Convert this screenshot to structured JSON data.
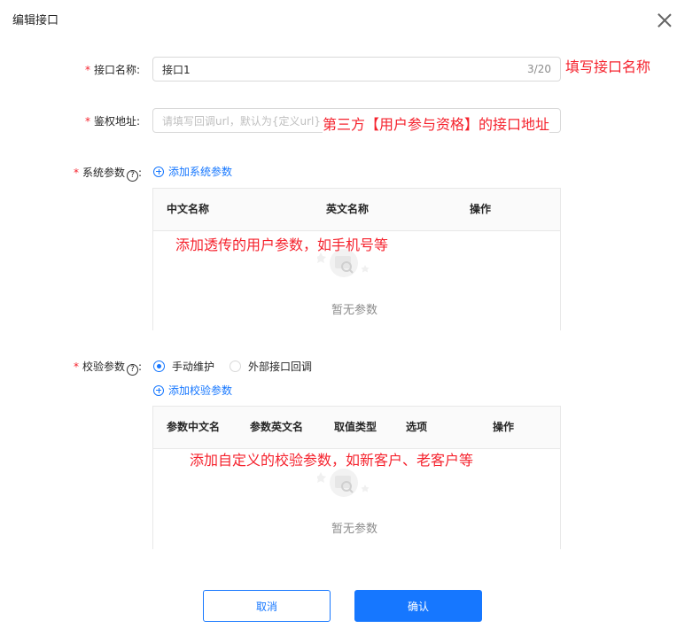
{
  "dialog": {
    "title": "编辑接口"
  },
  "form": {
    "name": {
      "label": "接口名称:",
      "value": "接口1",
      "count": "3/20"
    },
    "auth": {
      "label": "鉴权地址:",
      "placeholder": "请填写回调url，默认为{定义url}"
    },
    "system": {
      "label": "系统参数",
      "colon": ":",
      "help": "?",
      "add_label": "添加系统参数",
      "columns": [
        "中文名称",
        "英文名称",
        "操作"
      ],
      "empty_text": "暂无参数"
    },
    "check": {
      "label": "校验参数",
      "colon": ":",
      "help": "?",
      "options": [
        {
          "label": "手动维护",
          "checked": true
        },
        {
          "label": "外部接口回调",
          "checked": false
        }
      ],
      "add_label": "添加校验参数",
      "columns": [
        "参数中文名",
        "参数英文名",
        "取值类型",
        "选项",
        "操作"
      ],
      "empty_text": "暂无参数"
    }
  },
  "annotations": {
    "name_note": "填写接口名称",
    "auth_note": "第三方【用户参与资格】的接口地址",
    "system_note": "添加透传的用户参数，如手机号等",
    "check_note": "添加自定义的校验参数，如新客户、老客户等"
  },
  "buttons": {
    "cancel": "取消",
    "confirm": "确认"
  },
  "colors": {
    "primary": "#1677ff",
    "required": "#f5222d",
    "annotation": "#f5222d"
  }
}
